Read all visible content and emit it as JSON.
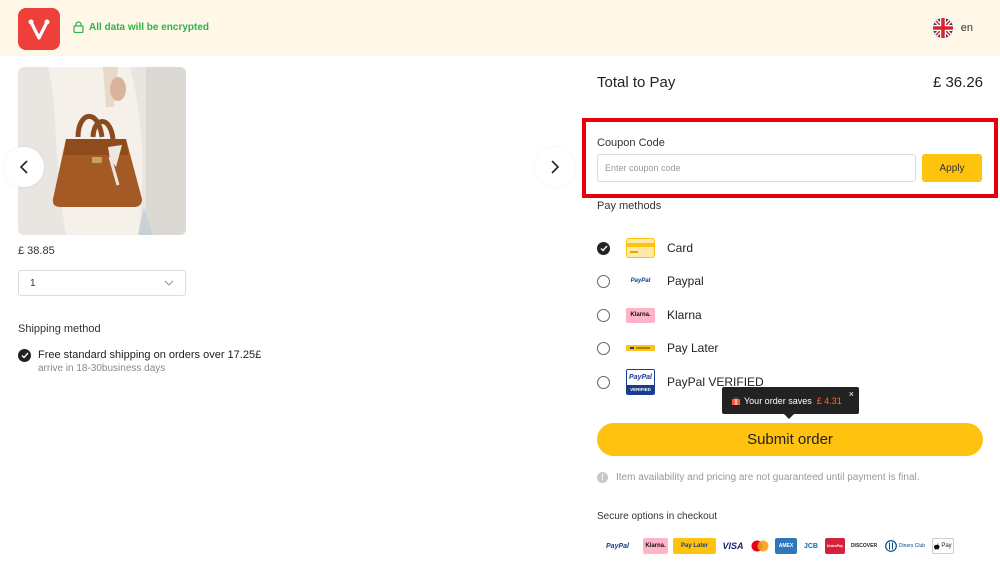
{
  "header": {
    "secure_note": "All data will be encrypted",
    "language": "en"
  },
  "product": {
    "price": "£ 38.85",
    "quantity": "1"
  },
  "shipping": {
    "title": "Shipping method",
    "option_label": "Free standard shipping on orders over 17.25£",
    "option_sub": "arrive in 18-30business days"
  },
  "summary": {
    "total_label": "Total to Pay",
    "total_value": "£ 36.26"
  },
  "coupon": {
    "label": "Coupon Code",
    "placeholder": "Enter coupon code",
    "value": "",
    "apply_label": "Apply"
  },
  "payment": {
    "title": "Pay methods",
    "methods": [
      {
        "label": "Card",
        "selected": true
      },
      {
        "label": "Paypal",
        "selected": false
      },
      {
        "label": "Klarna",
        "selected": false
      },
      {
        "label": "Pay Later",
        "selected": false
      },
      {
        "label": "PayPal VERIFIED",
        "selected": false
      }
    ],
    "logo_text": {
      "paypal": "PayPal",
      "klarna": "Klarna.",
      "verified_top": "PayPal",
      "verified_bottom": "VERIFIED"
    }
  },
  "tooltip": {
    "text": "Your order saves",
    "amount": "£ 4.31",
    "close": "×"
  },
  "submit": {
    "label": "Submit order",
    "notice": "Item availability and pricing are not guaranteed until payment is final."
  },
  "secure_options": {
    "title": "Secure options in checkout",
    "logos": [
      "PayPal",
      "Klarna.",
      "Pay Later",
      "VISA",
      "AMEX",
      "JCB",
      "UnionPay",
      "DISCOVER",
      "Diners Club",
      "Pay"
    ]
  },
  "colors": {
    "accent": "#ffc20e",
    "brand": "#ef3f3a",
    "secure_green": "#2db34a",
    "highlight_red": "#e5000b",
    "header_bg": "#fff7e8"
  }
}
